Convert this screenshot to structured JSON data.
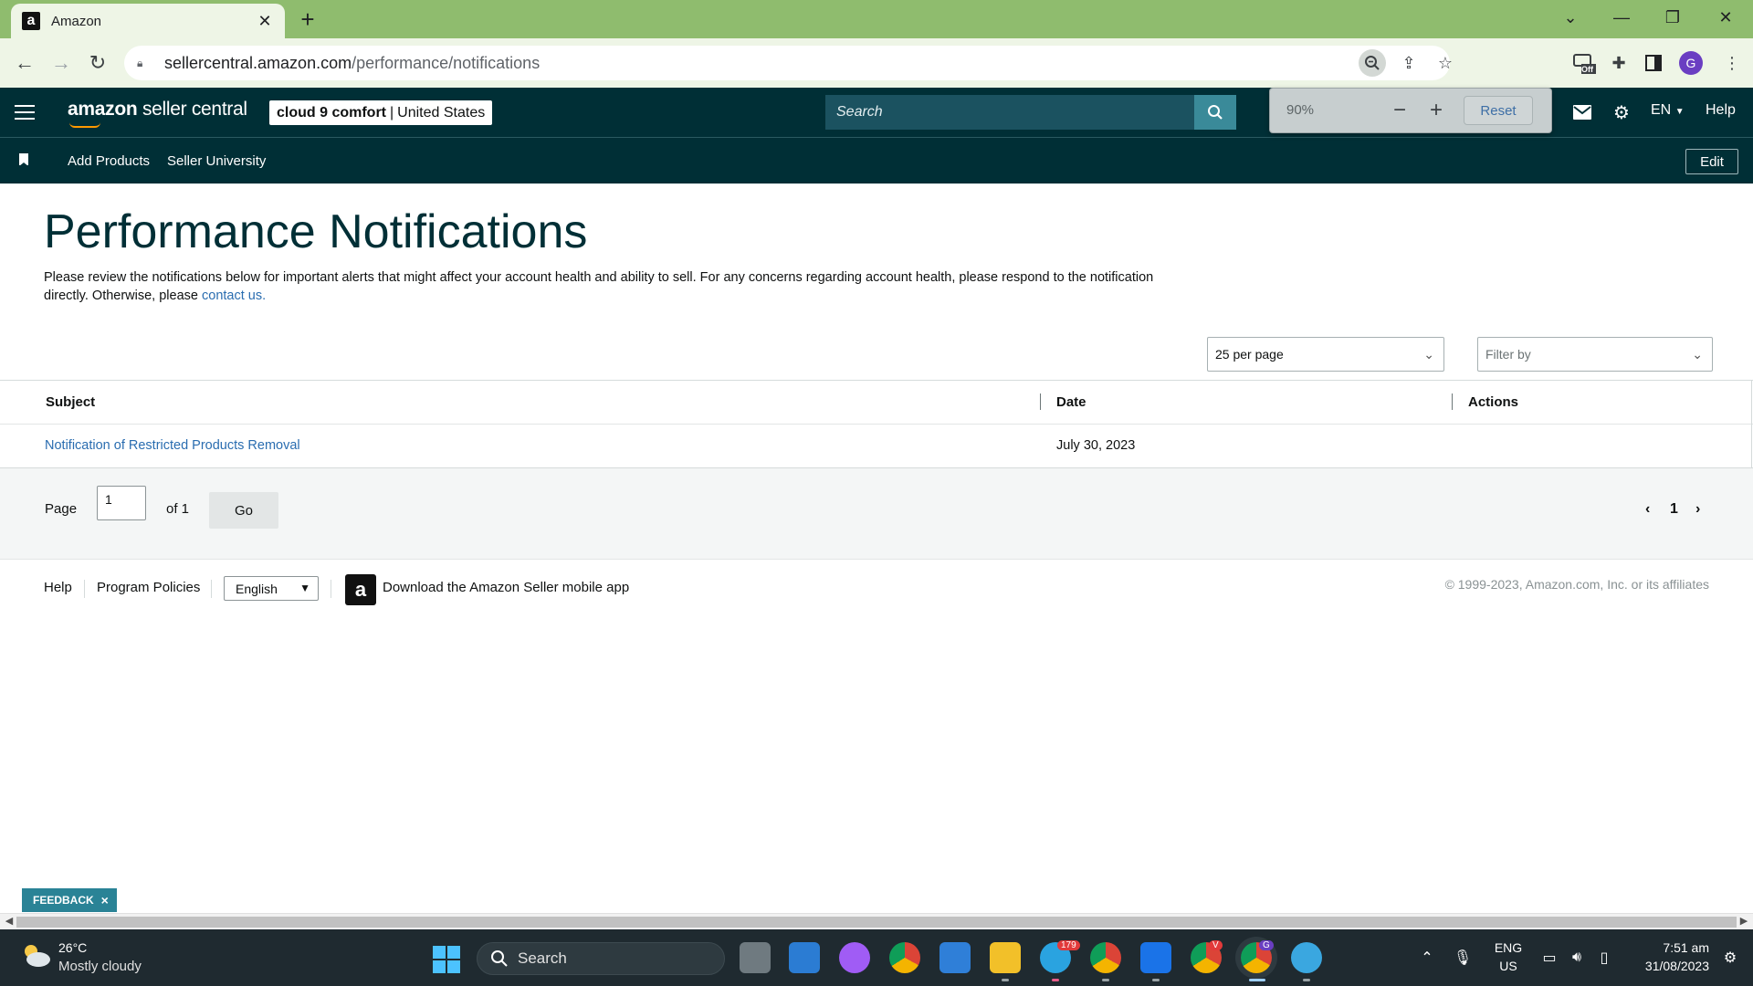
{
  "browser": {
    "tab_title": "Amazon",
    "tab_favicon": "a",
    "url_host": "sellercentral.amazon.com",
    "url_path": "/performance/notifications",
    "avatar_letter": "G",
    "ext_badge": "Off"
  },
  "zoom_popup": {
    "level": "90%",
    "reset_label": "Reset"
  },
  "header": {
    "logo_brand": "amazon",
    "logo_product": "seller central",
    "store_name": "cloud 9 comfort",
    "store_sep": "|",
    "store_region": "United States",
    "search_placeholder": "Search",
    "language": "EN",
    "help_label": "Help"
  },
  "subnav": {
    "items": [
      "Add Products",
      "Seller University"
    ],
    "edit_label": "Edit"
  },
  "page": {
    "title": "Performance Notifications",
    "description": "Please review the notifications below for important alerts that might affect your account health and ability to sell. For any concerns regarding account health, please respond to the notification directly. Otherwise, please ",
    "contact_link": "contact us.",
    "per_page": "25 per page",
    "filter_placeholder": "Filter by"
  },
  "table": {
    "columns": [
      "Subject",
      "Date",
      "Actions"
    ],
    "rows": [
      {
        "subject": "Notification of Restricted Products Removal",
        "date": "July 30, 2023",
        "actions": ""
      }
    ]
  },
  "pager": {
    "page_label": "Page",
    "current_page": "1",
    "of_label": "of 1",
    "go_label": "Go",
    "page_number": "1"
  },
  "footer": {
    "help": "Help",
    "program_policies": "Program Policies",
    "language": "English",
    "app_icon_letter": "a",
    "download_app": "Download the Amazon Seller mobile app",
    "copyright": "© 1999-2023, Amazon.com, Inc. or its affiliates"
  },
  "feedback": {
    "label": "FEEDBACK",
    "close": "×"
  },
  "taskbar": {
    "temperature": "26°C",
    "weather": "Mostly cloudy",
    "search_label": "Search",
    "telegram_badge": "179",
    "vivaldi_badge": "V",
    "chrome_badge": "G",
    "input_lang": "ENG",
    "input_region": "US",
    "time": "7:51 am",
    "date": "31/08/2023"
  },
  "colors": {
    "header_bg": "#002f36",
    "link": "#2a6db0",
    "tabstrip": "#8fbc6e",
    "feedback": "#2a8396"
  }
}
